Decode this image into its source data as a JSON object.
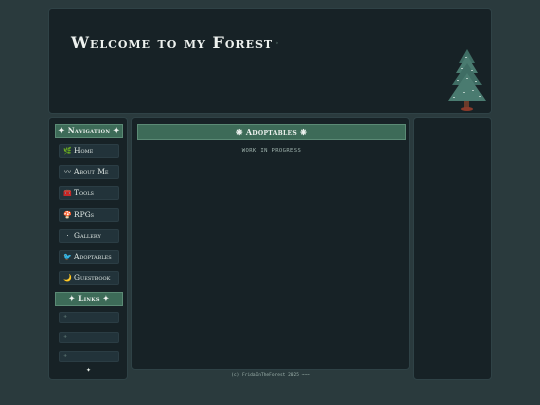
{
  "header": {
    "title": "Welcome to my Forest",
    "title_dot": "◦",
    "tree_icon": "pine-tree-icon"
  },
  "sidebar": {
    "nav_heading": "✦ Navigation ✦",
    "items": [
      {
        "label": "Home",
        "icon": "leaf-icon",
        "glyph": "🌿"
      },
      {
        "label": "About Me",
        "icon": "moustache-icon",
        "glyph": "〰"
      },
      {
        "label": "Tools",
        "icon": "toolbox-icon",
        "glyph": "🧰"
      },
      {
        "label": "RPGs",
        "icon": "mushroom-icon",
        "glyph": "🍄"
      },
      {
        "label": "Gallery",
        "icon": "dot-icon",
        "glyph": "·"
      },
      {
        "label": "Adoptables",
        "icon": "bird-icon",
        "glyph": "🐦"
      },
      {
        "label": "Guestbook",
        "icon": "moon-icon",
        "glyph": "🌙"
      }
    ],
    "links_heading": "✦ Links ✦",
    "links": [
      {
        "label": "+"
      },
      {
        "label": "+"
      },
      {
        "label": "+"
      }
    ],
    "star": "✦"
  },
  "main": {
    "heading": "❋ Adoptables ❋",
    "wip_text": "WORK IN PROGRESS"
  },
  "footer": {
    "text": "(c) FridaInTheForest 2025 ~~~"
  },
  "colors": {
    "background": "#2a3a3d",
    "panel": "#172226",
    "accent_green": "#3d6b58"
  }
}
